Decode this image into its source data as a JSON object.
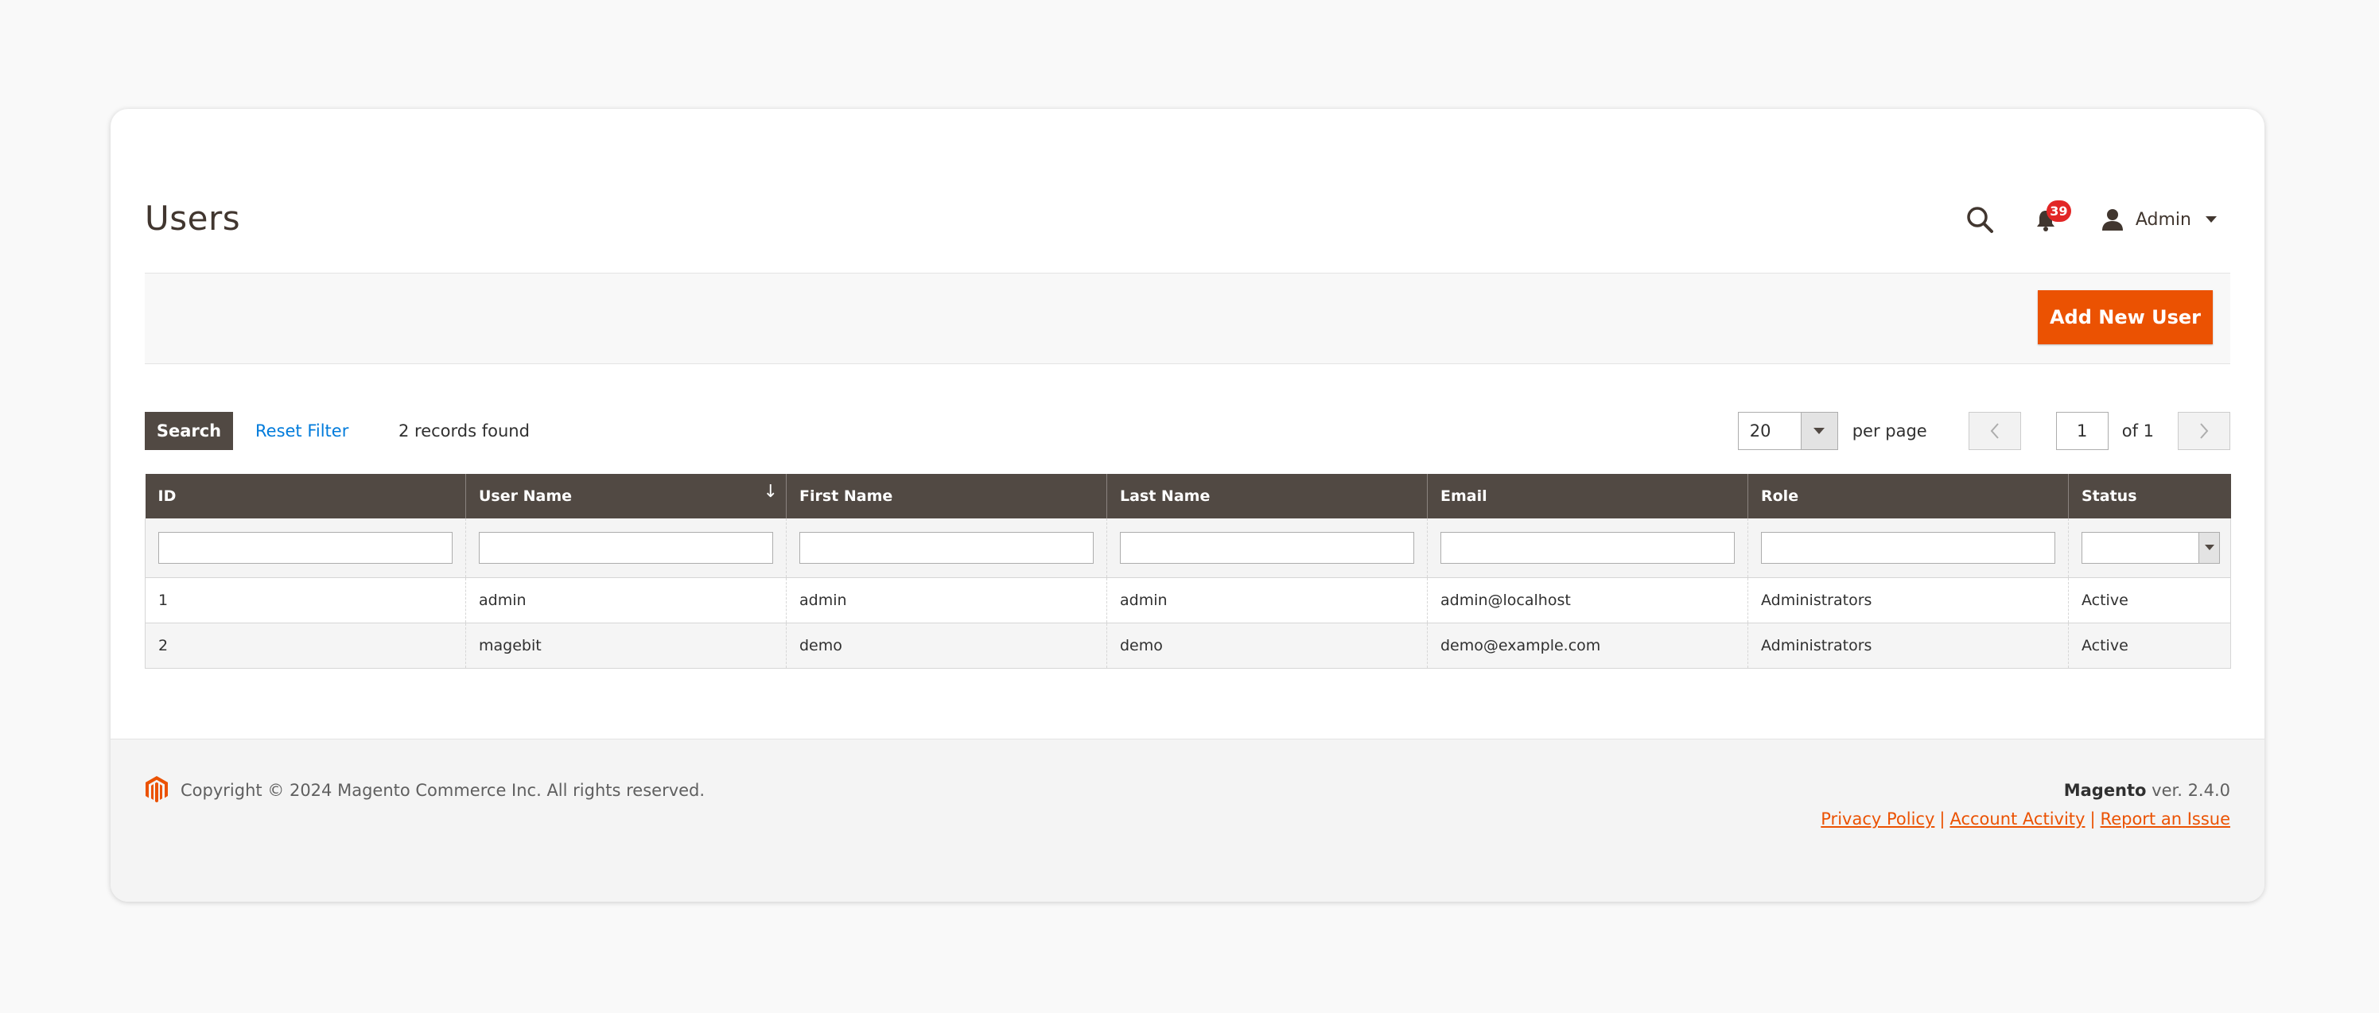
{
  "page": {
    "title": "Users"
  },
  "header": {
    "notifications_count": "39",
    "user_name": "Admin"
  },
  "actions": {
    "add_user_label": "Add New User"
  },
  "toolbar": {
    "search_label": "Search",
    "reset_filter_label": "Reset Filter",
    "records_found": "2 records found",
    "per_page_value": "20",
    "per_page_label": "per page",
    "current_page": "1",
    "of_pages": "of 1"
  },
  "grid": {
    "columns": [
      "ID",
      "User Name",
      "First Name",
      "Last Name",
      "Email",
      "Role",
      "Status"
    ],
    "sorted_column": "User Name",
    "sort_direction": "desc",
    "rows": [
      {
        "id": "1",
        "username": "admin",
        "firstname": "admin",
        "lastname": "admin",
        "email": "admin@localhost",
        "role": "Administrators",
        "status": "Active"
      },
      {
        "id": "2",
        "username": "magebit",
        "firstname": "demo",
        "lastname": "demo",
        "email": "demo@example.com",
        "role": "Administrators",
        "status": "Active"
      }
    ]
  },
  "footer": {
    "copyright": "Copyright © 2024 Magento Commerce Inc. All rights reserved.",
    "brand": "Magento",
    "version": " ver. 2.4.0",
    "links": [
      "Privacy Policy",
      "Account Activity",
      "Report an Issue"
    ]
  },
  "colors": {
    "accent": "#eb5202",
    "header_bg": "#514943",
    "link": "#007bdb",
    "badge": "#e22626"
  }
}
